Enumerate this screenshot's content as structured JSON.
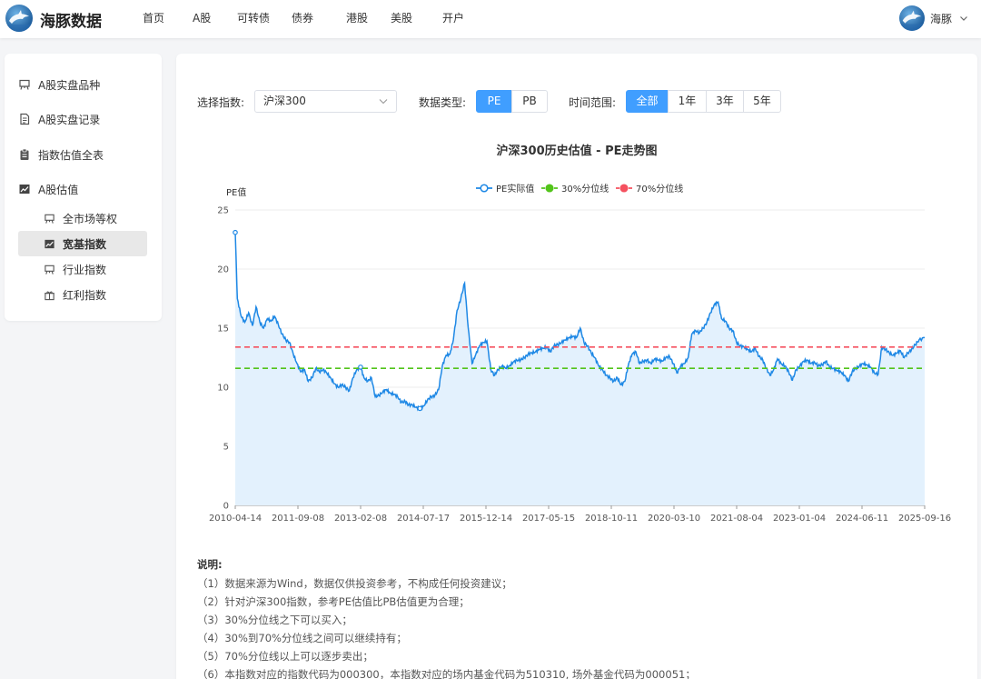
{
  "brand": "海豚数据",
  "nav": [
    {
      "label": "首页",
      "name": "nav-home",
      "w": 55
    },
    {
      "label": "A股",
      "name": "nav-a-share",
      "w": 49
    },
    {
      "label": "可转债",
      "name": "nav-convertible-bond",
      "w": 60
    },
    {
      "label": "债券",
      "name": "nav-bond",
      "w": 60
    },
    {
      "label": "港股",
      "name": "nav-hk-stock",
      "w": 49
    },
    {
      "label": "美股",
      "name": "nav-us-stock",
      "w": 57
    },
    {
      "label": "开户",
      "name": "nav-open-account",
      "w": 40
    }
  ],
  "user": {
    "name": "海豚"
  },
  "sidebar": {
    "items": [
      {
        "label": "A股实盘品种",
        "icon": "easel-icon"
      },
      {
        "label": "A股实盘记录",
        "icon": "document-icon"
      },
      {
        "label": "指数估值全表",
        "icon": "clipboard-icon"
      },
      {
        "label": "A股估值",
        "icon": "line-chart-icon"
      }
    ],
    "sub": [
      {
        "label": "全市场等权",
        "icon": "easel-icon",
        "active": false
      },
      {
        "label": "宽基指数",
        "icon": "line-chart-icon",
        "active": true
      },
      {
        "label": "行业指数",
        "icon": "easel-icon",
        "active": false
      },
      {
        "label": "红利指数",
        "icon": "gift-icon",
        "active": false
      }
    ]
  },
  "controls": {
    "index_label": "选择指数:",
    "index_value": "沪深300",
    "type_label": "数据类型:",
    "types": [
      "PE",
      "PB"
    ],
    "type_active": 0,
    "range_label": "时间范围:",
    "ranges": [
      "全部",
      "1年",
      "3年",
      "5年"
    ],
    "range_active": 0
  },
  "chart_data": {
    "type": "line",
    "title": "沪深300历史估值 - PE走势图",
    "ylabel": "PE值",
    "xlabel": "",
    "ylim": [
      0,
      25
    ],
    "yticks": [
      0,
      5,
      10,
      15,
      20,
      25
    ],
    "x_tick_labels": [
      "2010-04-14",
      "2011-09-08",
      "2013-02-08",
      "2014-07-17",
      "2015-12-14",
      "2017-05-15",
      "2018-10-11",
      "2020-03-10",
      "2021-08-04",
      "2023-01-04",
      "2024-06-11",
      "2025-09-16"
    ],
    "x_range": [
      "2010-04-14",
      "2025-09-16"
    ],
    "legend_position": "top-center",
    "grid": true,
    "series": [
      {
        "name": "PE实际值",
        "color": "#1e88e5",
        "area_fill": "#e3f1fd",
        "points": [
          [
            "2010-04-14",
            23.1
          ],
          [
            "2010-05-01",
            17.5
          ],
          [
            "2010-06-01",
            16.0
          ],
          [
            "2010-07-01",
            15.5
          ],
          [
            "2010-08-01",
            16.3
          ],
          [
            "2010-09-01",
            15.2
          ],
          [
            "2010-10-01",
            16.8
          ],
          [
            "2010-11-01",
            15.5
          ],
          [
            "2010-12-01",
            15.0
          ],
          [
            "2011-01-01",
            15.8
          ],
          [
            "2011-02-01",
            15.6
          ],
          [
            "2011-03-01",
            16.0
          ],
          [
            "2011-04-01",
            15.3
          ],
          [
            "2011-05-01",
            14.5
          ],
          [
            "2011-06-01",
            14.0
          ],
          [
            "2011-07-01",
            13.8
          ],
          [
            "2011-08-01",
            12.8
          ],
          [
            "2011-09-01",
            12.0
          ],
          [
            "2011-10-01",
            11.3
          ],
          [
            "2011-11-01",
            11.5
          ],
          [
            "2011-12-01",
            10.5
          ],
          [
            "2012-01-01",
            10.8
          ],
          [
            "2012-02-01",
            11.6
          ],
          [
            "2012-03-01",
            11.3
          ],
          [
            "2012-04-01",
            11.5
          ],
          [
            "2012-05-01",
            11.2
          ],
          [
            "2012-06-01",
            10.8
          ],
          [
            "2012-07-01",
            10.3
          ],
          [
            "2012-08-01",
            10.0
          ],
          [
            "2012-09-01",
            10.2
          ],
          [
            "2012-10-01",
            10.0
          ],
          [
            "2012-11-01",
            9.7
          ],
          [
            "2012-12-01",
            10.8
          ],
          [
            "2013-01-01",
            11.5
          ],
          [
            "2013-02-01",
            11.7
          ],
          [
            "2013-03-01",
            10.8
          ],
          [
            "2013-04-01",
            10.5
          ],
          [
            "2013-05-01",
            10.8
          ],
          [
            "2013-06-01",
            9.2
          ],
          [
            "2013-07-01",
            9.3
          ],
          [
            "2013-08-01",
            9.6
          ],
          [
            "2013-09-01",
            9.8
          ],
          [
            "2013-10-01",
            9.5
          ],
          [
            "2013-11-01",
            9.4
          ],
          [
            "2013-12-01",
            9.2
          ],
          [
            "2014-01-01",
            8.7
          ],
          [
            "2014-02-01",
            8.8
          ],
          [
            "2014-03-01",
            8.5
          ],
          [
            "2014-04-01",
            8.5
          ],
          [
            "2014-05-01",
            8.3
          ],
          [
            "2014-06-01",
            8.2
          ],
          [
            "2014-07-01",
            8.4
          ],
          [
            "2014-08-01",
            8.9
          ],
          [
            "2014-09-01",
            9.2
          ],
          [
            "2014-10-01",
            9.3
          ],
          [
            "2014-11-01",
            9.8
          ],
          [
            "2014-12-01",
            11.8
          ],
          [
            "2015-01-01",
            12.7
          ],
          [
            "2015-02-01",
            12.8
          ],
          [
            "2015-03-01",
            14.0
          ],
          [
            "2015-04-01",
            16.5
          ],
          [
            "2015-05-01",
            17.5
          ],
          [
            "2015-06-01",
            18.8
          ],
          [
            "2015-07-01",
            15.0
          ],
          [
            "2015-08-01",
            12.0
          ],
          [
            "2015-09-01",
            12.8
          ],
          [
            "2015-10-01",
            13.5
          ],
          [
            "2015-11-01",
            13.8
          ],
          [
            "2015-12-01",
            13.9
          ],
          [
            "2016-01-01",
            11.5
          ],
          [
            "2016-02-01",
            11.0
          ],
          [
            "2016-03-01",
            11.5
          ],
          [
            "2016-04-01",
            11.8
          ],
          [
            "2016-05-01",
            11.6
          ],
          [
            "2016-06-01",
            11.8
          ],
          [
            "2016-07-01",
            12.1
          ],
          [
            "2016-08-01",
            12.3
          ],
          [
            "2016-09-01",
            12.3
          ],
          [
            "2016-10-01",
            12.5
          ],
          [
            "2016-11-01",
            12.8
          ],
          [
            "2016-12-01",
            12.9
          ],
          [
            "2017-01-01",
            13.0
          ],
          [
            "2017-02-01",
            13.2
          ],
          [
            "2017-03-01",
            13.3
          ],
          [
            "2017-04-01",
            13.4
          ],
          [
            "2017-05-01",
            13.0
          ],
          [
            "2017-06-01",
            13.5
          ],
          [
            "2017-07-01",
            13.6
          ],
          [
            "2017-08-01",
            13.8
          ],
          [
            "2017-09-01",
            14.0
          ],
          [
            "2017-10-01",
            14.2
          ],
          [
            "2017-11-01",
            14.3
          ],
          [
            "2017-12-01",
            14.2
          ],
          [
            "2018-01-01",
            15.0
          ],
          [
            "2018-02-01",
            13.8
          ],
          [
            "2018-03-01",
            13.5
          ],
          [
            "2018-04-01",
            12.9
          ],
          [
            "2018-05-01",
            12.5
          ],
          [
            "2018-06-01",
            11.8
          ],
          [
            "2018-07-01",
            11.5
          ],
          [
            "2018-08-01",
            11.0
          ],
          [
            "2018-09-01",
            10.8
          ],
          [
            "2018-10-01",
            10.5
          ],
          [
            "2018-11-01",
            10.8
          ],
          [
            "2018-12-01",
            10.2
          ],
          [
            "2019-01-01",
            10.5
          ],
          [
            "2019-02-01",
            12.0
          ],
          [
            "2019-03-01",
            12.8
          ],
          [
            "2019-04-01",
            13.0
          ],
          [
            "2019-05-01",
            12.0
          ],
          [
            "2019-06-01",
            12.2
          ],
          [
            "2019-07-01",
            12.3
          ],
          [
            "2019-08-01",
            12.0
          ],
          [
            "2019-09-01",
            12.4
          ],
          [
            "2019-10-01",
            12.3
          ],
          [
            "2019-11-01",
            12.2
          ],
          [
            "2019-12-01",
            12.5
          ],
          [
            "2020-01-01",
            12.6
          ],
          [
            "2020-02-01",
            12.0
          ],
          [
            "2020-03-01",
            11.2
          ],
          [
            "2020-04-01",
            11.8
          ],
          [
            "2020-05-01",
            12.0
          ],
          [
            "2020-06-01",
            12.5
          ],
          [
            "2020-07-01",
            14.5
          ],
          [
            "2020-08-01",
            14.8
          ],
          [
            "2020-09-01",
            14.6
          ],
          [
            "2020-10-01",
            15.0
          ],
          [
            "2020-11-01",
            15.5
          ],
          [
            "2020-12-01",
            16.3
          ],
          [
            "2021-01-01",
            17.0
          ],
          [
            "2021-02-01",
            17.2
          ],
          [
            "2021-03-01",
            15.8
          ],
          [
            "2021-04-01",
            15.6
          ],
          [
            "2021-05-01",
            15.0
          ],
          [
            "2021-06-01",
            14.8
          ],
          [
            "2021-07-01",
            13.8
          ],
          [
            "2021-08-01",
            13.5
          ],
          [
            "2021-09-01",
            13.4
          ],
          [
            "2021-10-01",
            13.2
          ],
          [
            "2021-11-01",
            13.0
          ],
          [
            "2021-12-01",
            13.3
          ],
          [
            "2022-01-01",
            12.6
          ],
          [
            "2022-02-01",
            12.3
          ],
          [
            "2022-03-01",
            11.6
          ],
          [
            "2022-04-01",
            11.0
          ],
          [
            "2022-05-01",
            11.5
          ],
          [
            "2022-06-01",
            12.4
          ],
          [
            "2022-07-01",
            12.0
          ],
          [
            "2022-08-01",
            11.8
          ],
          [
            "2022-09-01",
            11.3
          ],
          [
            "2022-10-01",
            10.6
          ],
          [
            "2022-11-01",
            11.5
          ],
          [
            "2022-12-01",
            11.8
          ],
          [
            "2023-01-01",
            12.2
          ],
          [
            "2023-02-01",
            12.3
          ],
          [
            "2023-03-01",
            12.0
          ],
          [
            "2023-04-01",
            12.1
          ],
          [
            "2023-05-01",
            11.8
          ],
          [
            "2023-06-01",
            11.9
          ],
          [
            "2023-07-01",
            12.2
          ],
          [
            "2023-08-01",
            11.7
          ],
          [
            "2023-09-01",
            11.6
          ],
          [
            "2023-10-01",
            11.4
          ],
          [
            "2023-11-01",
            11.3
          ],
          [
            "2023-12-01",
            11.0
          ],
          [
            "2024-01-01",
            10.5
          ],
          [
            "2024-02-01",
            11.3
          ],
          [
            "2024-03-01",
            11.6
          ],
          [
            "2024-04-01",
            11.8
          ],
          [
            "2024-05-01",
            12.0
          ],
          [
            "2024-06-01",
            11.9
          ],
          [
            "2024-07-01",
            11.7
          ],
          [
            "2024-08-01",
            11.2
          ],
          [
            "2024-09-01",
            11.1
          ],
          [
            "2024-10-01",
            13.4
          ],
          [
            "2024-11-01",
            13.2
          ],
          [
            "2024-12-01",
            12.9
          ],
          [
            "2025-01-01",
            12.7
          ],
          [
            "2025-02-01",
            12.9
          ],
          [
            "2025-03-01",
            13.1
          ],
          [
            "2025-04-01",
            12.5
          ],
          [
            "2025-05-01",
            12.9
          ],
          [
            "2025-06-01",
            13.2
          ],
          [
            "2025-07-01",
            13.6
          ],
          [
            "2025-08-01",
            14.0
          ],
          [
            "2025-09-16",
            14.2
          ]
        ]
      },
      {
        "name": "30%分位线",
        "color": "#52c41a",
        "value": 11.6
      },
      {
        "name": "70%分位线",
        "color": "#f5515f",
        "value": 13.4
      }
    ]
  },
  "notes": {
    "title": "说明:",
    "lines": [
      "（1）数据来源为Wind，数据仅供投资参考，不构成任何投资建议；",
      "（2）针对沪深300指数，参考PE估值比PB估值更为合理；",
      "（3）30%分位线之下可以买入；",
      "（4）30%到70%分位线之间可以继续持有；",
      "（5）70%分位线以上可以逐步卖出；",
      "（6）本指数对应的指数代码为000300，本指数对应的场内基金代码为510310, 场外基金代码为000051；"
    ]
  }
}
